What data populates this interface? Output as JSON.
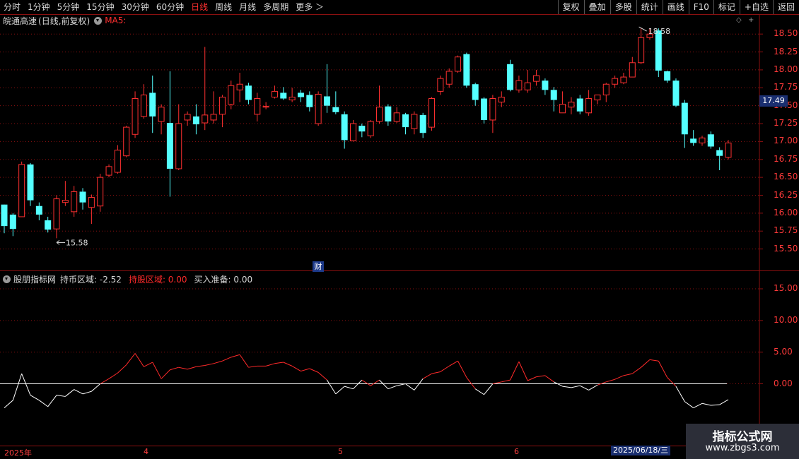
{
  "toolbar": {
    "periods": [
      "分时",
      "1分钟",
      "5分钟",
      "15分钟",
      "30分钟",
      "60分钟",
      "日线",
      "周线",
      "月线",
      "多周期",
      "更多"
    ],
    "active_index": 6,
    "right_buttons": [
      "复权",
      "叠加",
      "多股",
      "统计",
      "画线",
      "F10",
      "标记",
      "+自选",
      "返回"
    ]
  },
  "main": {
    "stock": "皖通高速",
    "period_info": "(日线,前复权)",
    "ma_label": "MA5:",
    "price_labels": [
      "18.50",
      "18.25",
      "18.00",
      "17.75",
      "17.50",
      "17.25",
      "17.00",
      "16.75",
      "16.50",
      "16.25",
      "16.00",
      "15.75",
      "15.50"
    ],
    "current_price": "17.49",
    "high_note": "18.58",
    "low_note": "15.58",
    "fin_icon": "财"
  },
  "indicator": {
    "name": "股朋指标网",
    "line1": "持币区域: -2.52",
    "line2": "持股区域: 0.00",
    "line3": "买入准备: 0.00",
    "labels": [
      "15.00",
      "10.00",
      "5.00",
      "0.00"
    ]
  },
  "dates": {
    "start": "2025年",
    "m4": "4",
    "m5": "5",
    "m6": "6",
    "cursor": "2025/06/18/三"
  },
  "watermark": {
    "title": "指标公式网",
    "url": "www.zbgs3.com"
  },
  "colors": {
    "up": "#ff3030",
    "down": "#54ffff",
    "grid": "#8b1010"
  },
  "chart_data": {
    "type": "candlestick",
    "price_ylim": [
      15.5,
      18.5
    ],
    "indicator_ylim": [
      -5,
      17.5
    ],
    "candles": [
      [
        16.12,
        15.82,
        16.12,
        15.72
      ],
      [
        15.98,
        15.78,
        16.0,
        15.68
      ],
      [
        15.95,
        16.68,
        16.72,
        15.95
      ],
      [
        16.68,
        16.18,
        16.7,
        16.1
      ],
      [
        16.1,
        15.98,
        16.15,
        15.9
      ],
      [
        15.9,
        15.77,
        15.95,
        15.73
      ],
      [
        15.78,
        16.2,
        16.25,
        15.65
      ],
      [
        16.15,
        16.18,
        16.45,
        16.1
      ],
      [
        16.02,
        16.3,
        16.38,
        15.95
      ],
      [
        16.3,
        16.15,
        16.35,
        16.05
      ],
      [
        16.08,
        16.22,
        16.26,
        15.85
      ],
      [
        16.1,
        16.5,
        16.55,
        16.02
      ],
      [
        16.53,
        16.65,
        16.68,
        16.5
      ],
      [
        16.57,
        16.88,
        16.95,
        16.55
      ],
      [
        16.8,
        17.2,
        17.22,
        16.78
      ],
      [
        17.1,
        17.6,
        17.7,
        17.05
      ],
      [
        17.35,
        17.65,
        17.8,
        17.32
      ],
      [
        17.68,
        17.35,
        17.92,
        17.12
      ],
      [
        17.28,
        17.48,
        17.52,
        17.1
      ],
      [
        17.26,
        16.62,
        17.98,
        16.23
      ],
      [
        16.62,
        17.25,
        17.52,
        16.6
      ],
      [
        17.3,
        17.38,
        17.42,
        17.22
      ],
      [
        17.35,
        17.24,
        17.52,
        17.1
      ],
      [
        17.26,
        17.37,
        18.32,
        17.16
      ],
      [
        17.3,
        17.38,
        17.7,
        17.25
      ],
      [
        17.38,
        17.62,
        17.65,
        17.2
      ],
      [
        17.52,
        17.78,
        17.85,
        17.45
      ],
      [
        17.72,
        17.8,
        17.96,
        17.55
      ],
      [
        17.78,
        17.58,
        17.82,
        17.52
      ],
      [
        17.38,
        17.6,
        17.68,
        17.28
      ],
      [
        17.48,
        17.49,
        17.55,
        17.45
      ],
      [
        17.62,
        17.7,
        17.78,
        17.6
      ],
      [
        17.68,
        17.6,
        17.76,
        17.58
      ],
      [
        17.58,
        17.62,
        17.75,
        17.55
      ],
      [
        17.68,
        17.62,
        17.72,
        17.55
      ],
      [
        17.65,
        17.48,
        17.7,
        17.42
      ],
      [
        17.25,
        17.66,
        17.7,
        17.22
      ],
      [
        17.63,
        17.5,
        18.08,
        17.4
      ],
      [
        17.48,
        17.41,
        17.7,
        17.38
      ],
      [
        17.38,
        17.02,
        17.42,
        16.9
      ],
      [
        17.01,
        17.25,
        17.3,
        17.0
      ],
      [
        17.22,
        17.14,
        17.25,
        17.06
      ],
      [
        17.08,
        17.28,
        17.3,
        17.05
      ],
      [
        17.28,
        17.48,
        17.78,
        17.25
      ],
      [
        17.49,
        17.28,
        17.52,
        17.22
      ],
      [
        17.28,
        17.4,
        17.48,
        17.26
      ],
      [
        17.38,
        17.2,
        17.4,
        17.1
      ],
      [
        17.18,
        17.38,
        17.42,
        17.1
      ],
      [
        17.37,
        17.12,
        17.4,
        17.05
      ],
      [
        17.2,
        17.6,
        17.62,
        17.15
      ],
      [
        17.7,
        17.88,
        17.92,
        17.65
      ],
      [
        17.8,
        17.98,
        18.02,
        17.75
      ],
      [
        17.98,
        18.18,
        18.2,
        17.96
      ],
      [
        18.22,
        17.78,
        18.24,
        17.75
      ],
      [
        17.8,
        17.58,
        17.82,
        17.5
      ],
      [
        17.6,
        17.3,
        17.62,
        17.25
      ],
      [
        17.3,
        17.6,
        17.65,
        17.12
      ],
      [
        17.55,
        17.62,
        17.7,
        17.48
      ],
      [
        18.08,
        17.72,
        18.14,
        17.7
      ],
      [
        17.72,
        17.85,
        17.92,
        17.68
      ],
      [
        17.72,
        17.82,
        18.0,
        17.68
      ],
      [
        17.84,
        17.92,
        18.0,
        17.78
      ],
      [
        17.85,
        17.72,
        17.88,
        17.65
      ],
      [
        17.72,
        17.58,
        17.76,
        17.42
      ],
      [
        17.4,
        17.52,
        17.7,
        17.4
      ],
      [
        17.48,
        17.55,
        17.62,
        17.38
      ],
      [
        17.6,
        17.42,
        17.65,
        17.38
      ],
      [
        17.4,
        17.6,
        17.72,
        17.36
      ],
      [
        17.58,
        17.65,
        17.62,
        17.52
      ],
      [
        17.65,
        17.8,
        17.82,
        17.55
      ],
      [
        17.8,
        17.88,
        17.92,
        17.75
      ],
      [
        17.82,
        17.9,
        17.96,
        17.8
      ],
      [
        17.9,
        18.1,
        18.18,
        17.9
      ],
      [
        18.1,
        18.45,
        18.58,
        18.08
      ],
      [
        18.45,
        18.5,
        18.58,
        18.42
      ],
      [
        18.55,
        17.99,
        18.58,
        17.9
      ],
      [
        17.98,
        17.85,
        17.99,
        17.82
      ],
      [
        17.85,
        17.5,
        17.88,
        17.48
      ],
      [
        17.54,
        17.1,
        17.58,
        16.91
      ],
      [
        17.04,
        16.98,
        17.16,
        16.94
      ],
      [
        16.98,
        17.05,
        17.08,
        16.94
      ],
      [
        17.1,
        16.93,
        17.14,
        16.9
      ],
      [
        16.88,
        16.8,
        16.92,
        16.6
      ],
      [
        16.78,
        16.98,
        17.02,
        16.75
      ]
    ],
    "indicator": [
      -3.8,
      -2.6,
      1.6,
      -1.8,
      -2.6,
      -3.6,
      -1.8,
      -2.0,
      -0.9,
      -1.6,
      -1.2,
      0.0,
      0.8,
      1.7,
      3.0,
      4.8,
      2.7,
      3.4,
      0.8,
      2.2,
      2.6,
      2.3,
      2.7,
      2.9,
      3.2,
      3.6,
      4.2,
      4.6,
      2.6,
      2.8,
      2.8,
      3.2,
      3.4,
      2.8,
      2.0,
      2.4,
      1.8,
      0.6,
      -1.6,
      -0.4,
      -0.8,
      0.6,
      -0.3,
      0.6,
      -0.8,
      -0.3,
      0.0,
      -1.0,
      0.8,
      1.6,
      1.9,
      2.8,
      3.6,
      1.0,
      -0.8,
      -1.7,
      0.0,
      0.3,
      0.6,
      3.5,
      0.5,
      1.1,
      1.3,
      0.3,
      -0.4,
      -0.6,
      -0.3,
      -1.0,
      -0.2,
      0.3,
      0.7,
      1.3,
      1.6,
      2.6,
      3.8,
      3.6,
      1.0,
      -0.4,
      -2.8,
      -3.8,
      -3.1,
      -3.4,
      -3.3,
      -2.5
    ]
  }
}
